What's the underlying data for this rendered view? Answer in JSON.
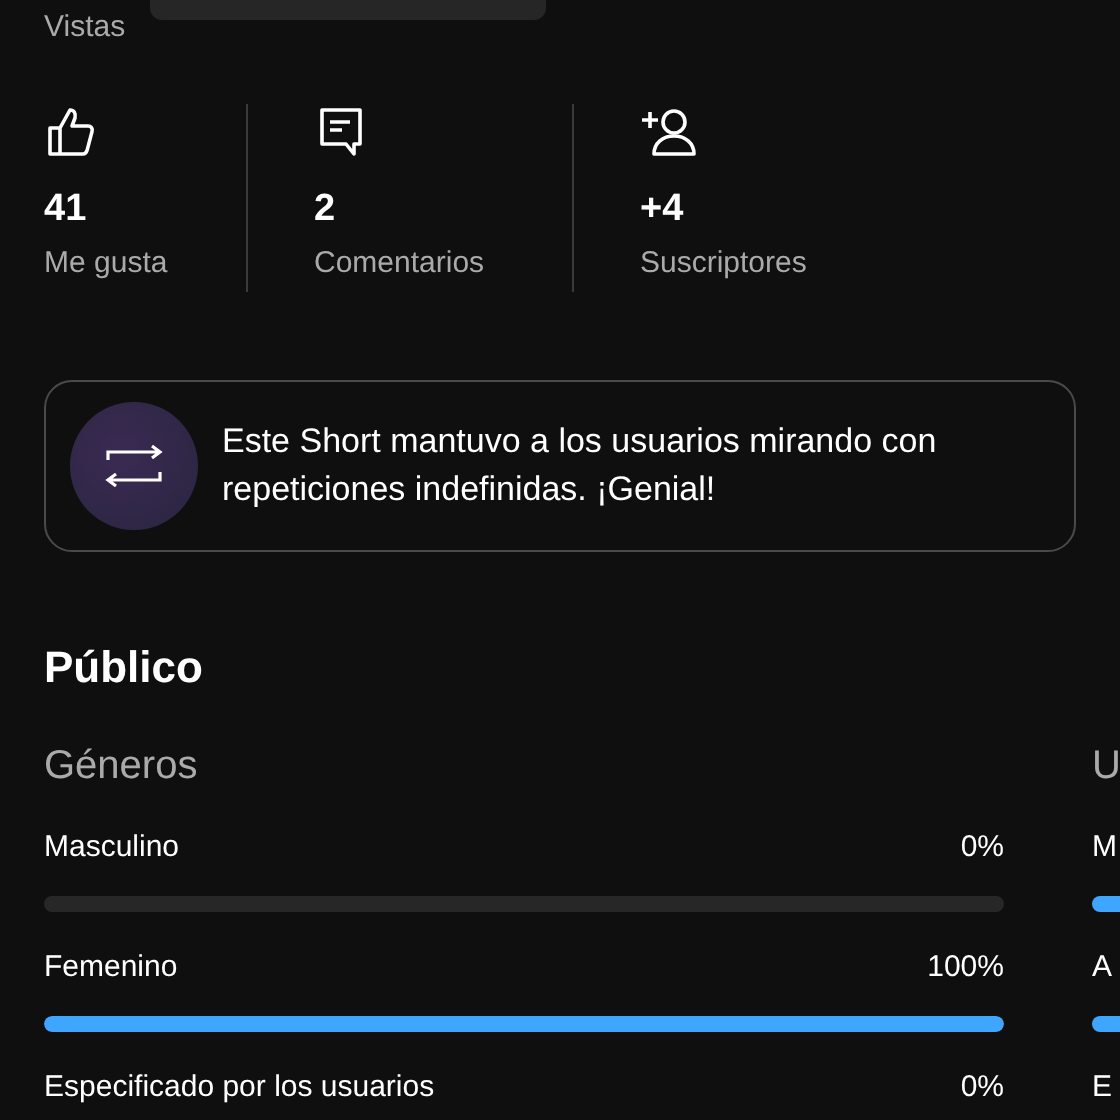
{
  "views_label": "Vistas",
  "stats": [
    {
      "kind": "likes",
      "value": "41",
      "label": "Me gusta"
    },
    {
      "kind": "comments",
      "value": "2",
      "label": "Comentarios"
    },
    {
      "kind": "subscribers",
      "value": "+4",
      "label": "Suscriptores"
    }
  ],
  "insight": {
    "kind": "loop",
    "text": "Este Short mantuvo a los usuarios mirando con repeticiones indefinidas. ¡Genial!"
  },
  "audience": {
    "title": "Público",
    "panels": [
      {
        "title": "Géneros",
        "rows": [
          {
            "label": "Masculino",
            "reading": "0%",
            "level": 0
          },
          {
            "label": "Femenino",
            "reading": "100%",
            "level": 1
          },
          {
            "label": "Especificado por los usuarios",
            "reading": "0%"
          }
        ]
      },
      {
        "title": "U",
        "rows": [
          {
            "label": "M"
          },
          {
            "label": "A"
          },
          {
            "label": "E"
          }
        ]
      }
    ]
  }
}
